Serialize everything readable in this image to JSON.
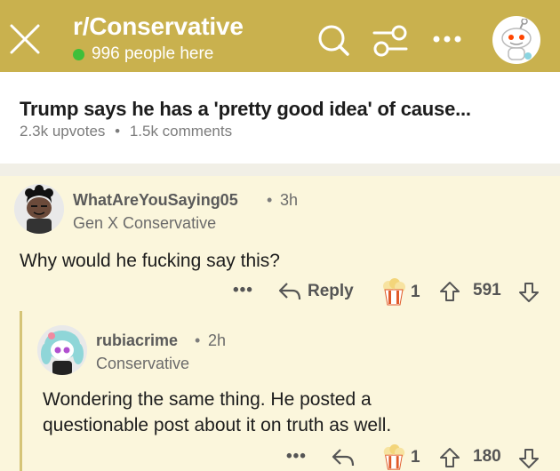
{
  "header": {
    "subreddit": "r/Conservative",
    "online_count": "996 people here",
    "bg_color": "#c9b14e",
    "icons": [
      "close-icon",
      "search-icon",
      "filter-icon",
      "more-icon",
      "avatar-icon"
    ]
  },
  "post": {
    "title": "Trump says he has a 'pretty good idea' of cause...",
    "upvotes": "2.3k upvotes",
    "separator": "•",
    "comments": "1.5k comments"
  },
  "comments": [
    {
      "username": "WhatAreYouSaying05",
      "separator": "•",
      "age": "3h",
      "flair": "Gen X Conservative",
      "body": "Why would he fucking say this?",
      "more": "•••",
      "reply_label": "Reply",
      "award_count": "1",
      "score": "591"
    },
    {
      "username": "rubiacrime",
      "separator": "•",
      "age": "2h",
      "flair": "Conservative",
      "body_lines": [
        "Wondering the same thing. He posted a",
        "questionable post about it on truth as well."
      ],
      "more": "•••",
      "award_count": "1",
      "score": "180"
    }
  ]
}
